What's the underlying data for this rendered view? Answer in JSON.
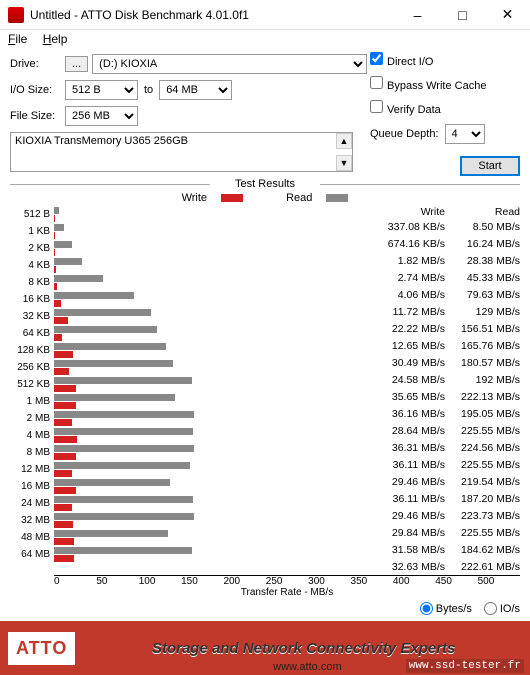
{
  "window": {
    "title": "Untitled - ATTO Disk Benchmark 4.01.0f1"
  },
  "menu": {
    "file": "File",
    "help": "Help"
  },
  "form": {
    "drive_label": "Drive:",
    "browse": "...",
    "drive_value": "(D:) KIOXIA",
    "iosize_label": "I/O Size:",
    "io_from": "512 B",
    "io_to_word": "to",
    "io_to": "64 MB",
    "filesize_label": "File Size:",
    "filesize": "256 MB"
  },
  "opts": {
    "direct_io": "Direct I/O",
    "bypass": "Bypass Write Cache",
    "verify": "Verify Data",
    "queue_label": "Queue Depth:",
    "queue_value": "4",
    "start": "Start"
  },
  "desc": "KIOXIA TransMemory U365 256GB",
  "results_title": "Test Results",
  "legend": {
    "write": "Write",
    "read": "Read"
  },
  "table_hdr": {
    "write": "Write",
    "read": "Read"
  },
  "xaxis_label": "Transfer Rate - MB/s",
  "unit": {
    "bytes": "Bytes/s",
    "ios": "IO/s"
  },
  "footer": {
    "logo": "ATTO",
    "tag": "Storage and Network Connectivity Experts",
    "url": "www.atto.com",
    "stamp": "www.ssd-tester.fr"
  },
  "chart_data": {
    "type": "bar",
    "title": "Test Results",
    "xlabel": "Transfer Rate - MB/s",
    "xlim": [
      0,
      500
    ],
    "xticks": [
      0,
      50,
      100,
      150,
      200,
      250,
      300,
      350,
      400,
      450,
      500
    ],
    "categories": [
      "512 B",
      "1 KB",
      "2 KB",
      "4 KB",
      "8 KB",
      "16 KB",
      "32 KB",
      "64 KB",
      "128 KB",
      "256 KB",
      "512 KB",
      "1 MB",
      "2 MB",
      "4 MB",
      "8 MB",
      "12 MB",
      "16 MB",
      "24 MB",
      "32 MB",
      "48 MB",
      "64 MB"
    ],
    "series": [
      {
        "name": "Write",
        "units": "as_displayed",
        "display": [
          "337.08 KB/s",
          "674.16 KB/s",
          "1.82 MB/s",
          "2.74 MB/s",
          "4.06 MB/s",
          "11.72 MB/s",
          "22.22 MB/s",
          "12.65 MB/s",
          "30.49 MB/s",
          "24.58 MB/s",
          "35.65 MB/s",
          "36.16 MB/s",
          "28.64 MB/s",
          "36.31 MB/s",
          "36.11 MB/s",
          "29.46 MB/s",
          "36.11 MB/s",
          "29.46 MB/s",
          "29.84 MB/s",
          "31.58 MB/s",
          "32.63 MB/s"
        ],
        "values_mb_s": [
          0.329,
          0.658,
          1.82,
          2.74,
          4.06,
          11.72,
          22.22,
          12.65,
          30.49,
          24.58,
          35.65,
          36.16,
          28.64,
          36.31,
          36.11,
          29.46,
          36.11,
          29.46,
          29.84,
          31.58,
          32.63
        ]
      },
      {
        "name": "Read",
        "units": "as_displayed",
        "display": [
          "8.50 MB/s",
          "16.24 MB/s",
          "28.38 MB/s",
          "45.33 MB/s",
          "79.63 MB/s",
          "129 MB/s",
          "156.51 MB/s",
          "165.76 MB/s",
          "180.57 MB/s",
          "192 MB/s",
          "222.13 MB/s",
          "195.05 MB/s",
          "225.55 MB/s",
          "224.56 MB/s",
          "225.55 MB/s",
          "219.54 MB/s",
          "187.20 MB/s",
          "223.73 MB/s",
          "225.55 MB/s",
          "184.62 MB/s",
          "222.61 MB/s"
        ],
        "values_mb_s": [
          8.5,
          16.24,
          28.38,
          45.33,
          79.63,
          129,
          156.51,
          165.76,
          180.57,
          192,
          222.13,
          195.05,
          225.55,
          224.56,
          225.55,
          219.54,
          187.2,
          223.73,
          225.55,
          184.62,
          222.61
        ]
      }
    ]
  }
}
